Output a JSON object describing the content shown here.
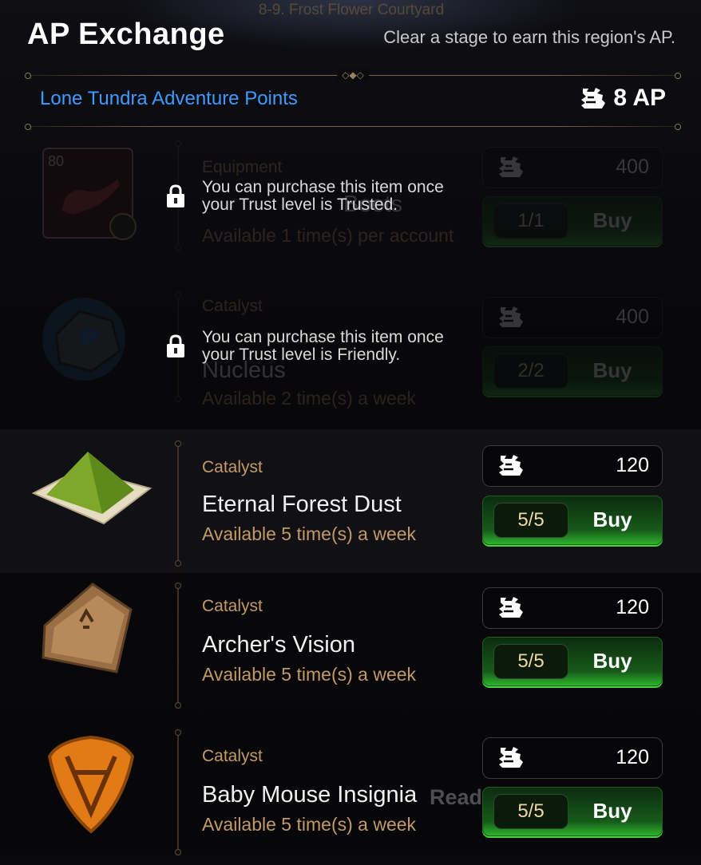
{
  "header": {
    "location": "8-9. Frost Flower Courtyard",
    "title": "AP Exchange",
    "subtitle": "Clear a stage to earn this region's AP."
  },
  "region": {
    "label": "Lone Tundra Adventure Points",
    "total": "8 AP"
  },
  "items": [
    {
      "category": "Equipment",
      "name": "Boots",
      "availability": "Available 1 time(s) per account",
      "price": "400",
      "count": "1/1",
      "buy_label": "Buy",
      "level_badge": "80",
      "locked": true,
      "lock_message": "You can purchase this item once your Trust level is Trusted."
    },
    {
      "category": "Catalyst",
      "name": "Nucleus",
      "availability": "Available 2 time(s) a week",
      "price": "400",
      "count": "2/2",
      "buy_label": "Buy",
      "locked": true,
      "lock_message": "You can purchase this item once your Trust level is Friendly."
    },
    {
      "category": "Catalyst",
      "name": "Eternal Forest Dust",
      "availability": "Available 5 time(s) a week",
      "price": "120",
      "count": "5/5",
      "buy_label": "Buy",
      "locked": false
    },
    {
      "category": "Catalyst",
      "name": "Archer's Vision",
      "availability": "Available 5 time(s) a week",
      "price": "120",
      "count": "5/5",
      "buy_label": "Buy",
      "locked": false
    },
    {
      "category": "Catalyst",
      "name": "Baby Mouse Insignia",
      "availability": "Available 5 time(s) a week",
      "price": "120",
      "count": "5/5",
      "buy_label": "Buy",
      "locked": false
    }
  ],
  "background_text": "Ready",
  "colors": {
    "region_label": "#3d9bff",
    "category": "#c39a66",
    "buy_green": "#2fb82e"
  }
}
